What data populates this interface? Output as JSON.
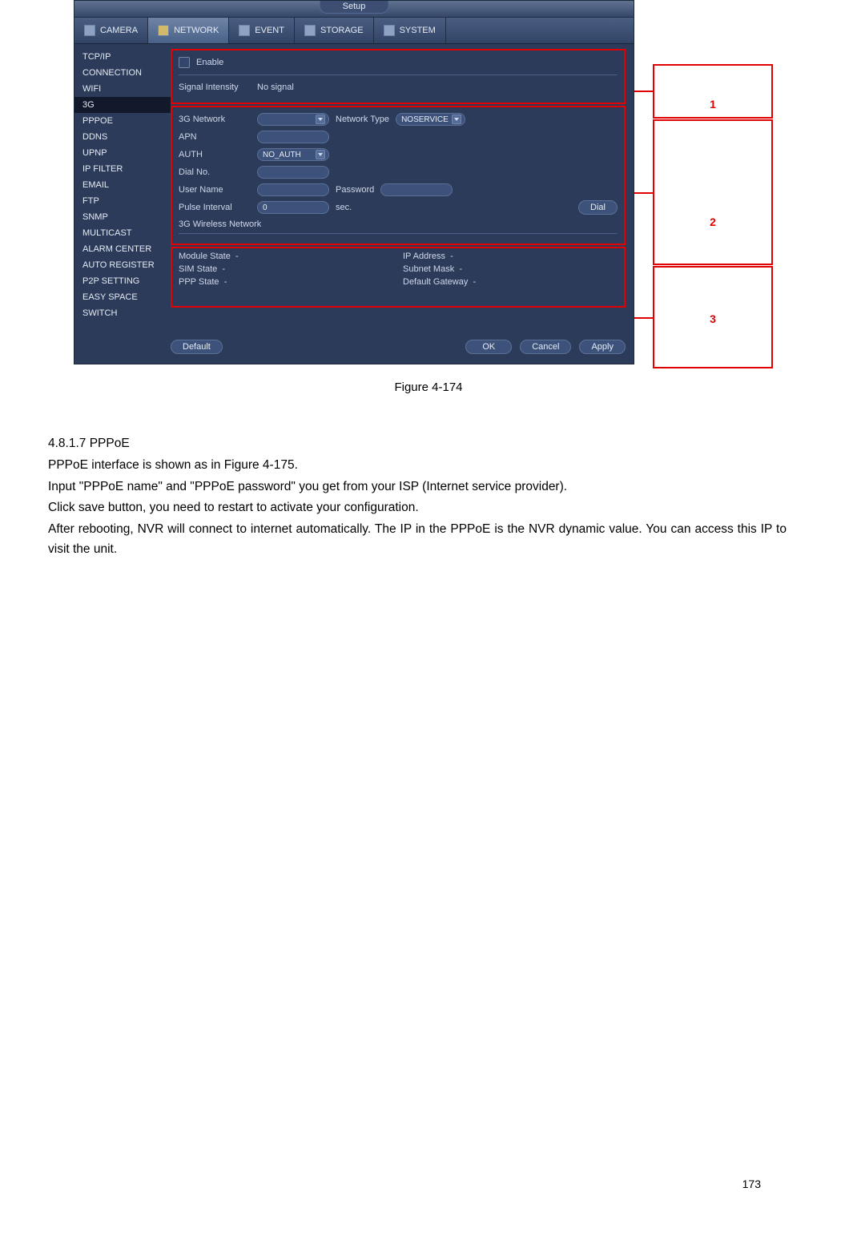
{
  "window": {
    "title": "Setup",
    "tabs": [
      {
        "label": "CAMERA",
        "iconCls": "cam"
      },
      {
        "label": "NETWORK",
        "iconCls": "net",
        "selected": true
      },
      {
        "label": "EVENT",
        "iconCls": "evt"
      },
      {
        "label": "STORAGE",
        "iconCls": "sto"
      },
      {
        "label": "SYSTEM",
        "iconCls": "sys"
      }
    ],
    "sidebar": [
      {
        "label": "TCP/IP"
      },
      {
        "label": "CONNECTION"
      },
      {
        "label": "WIFI"
      },
      {
        "label": "3G",
        "selected": true
      },
      {
        "label": "PPPOE"
      },
      {
        "label": "DDNS"
      },
      {
        "label": "UPNP"
      },
      {
        "label": "IP FILTER"
      },
      {
        "label": "EMAIL"
      },
      {
        "label": "FTP"
      },
      {
        "label": "SNMP"
      },
      {
        "label": "MULTICAST"
      },
      {
        "label": "ALARM CENTER"
      },
      {
        "label": "AUTO REGISTER"
      },
      {
        "label": "P2P SETTING"
      },
      {
        "label": "EASY SPACE"
      },
      {
        "label": "SWITCH"
      }
    ],
    "panel1": {
      "enable_label": "Enable",
      "signal_label": "Signal Intensity",
      "signal_value": "No signal"
    },
    "panel2": {
      "g3network_label": "3G Network",
      "g3network_value": "",
      "nettype_label": "Network Type",
      "nettype_value": "NOSERVICE",
      "apn_label": "APN",
      "apn_value": "",
      "auth_label": "AUTH",
      "auth_value": "NO_AUTH",
      "dial_label": "Dial No.",
      "dial_value": "",
      "user_label": "User Name",
      "user_value": "",
      "pass_label": "Password",
      "pass_value": "",
      "pulse_label": "Pulse Interval",
      "pulse_value": "0",
      "pulse_unit": "sec.",
      "dial_btn": "Dial",
      "wireless_header": "3G Wireless Network"
    },
    "panel3": {
      "module_label": "Module State",
      "module_value": "-",
      "ip_label": "IP Address",
      "ip_value": "-",
      "sim_label": "SIM State",
      "sim_value": "-",
      "mask_label": "Subnet Mask",
      "mask_value": "-",
      "ppp_label": "PPP State",
      "ppp_value": "-",
      "gw_label": "Default Gateway",
      "gw_value": "-"
    },
    "buttons": {
      "default": "Default",
      "ok": "OK",
      "cancel": "Cancel",
      "apply": "Apply"
    }
  },
  "callouts": {
    "n1": "1",
    "n2": "2",
    "n3": "3"
  },
  "caption": "Figure 4-174",
  "body": {
    "heading": "4.8.1.7 PPPoE",
    "p1": "PPPoE interface is shown as in Figure 4-175.",
    "p2": "Input \"PPPoE name\" and \"PPPoE password\" you get from your ISP (Internet service provider).",
    "p3": "Click save button, you need to restart to activate your configuration.",
    "p4": "After rebooting, NVR will connect to internet automatically. The IP in the PPPoE is the NVR dynamic value. You can access this IP to visit the unit."
  },
  "page_number": "173"
}
